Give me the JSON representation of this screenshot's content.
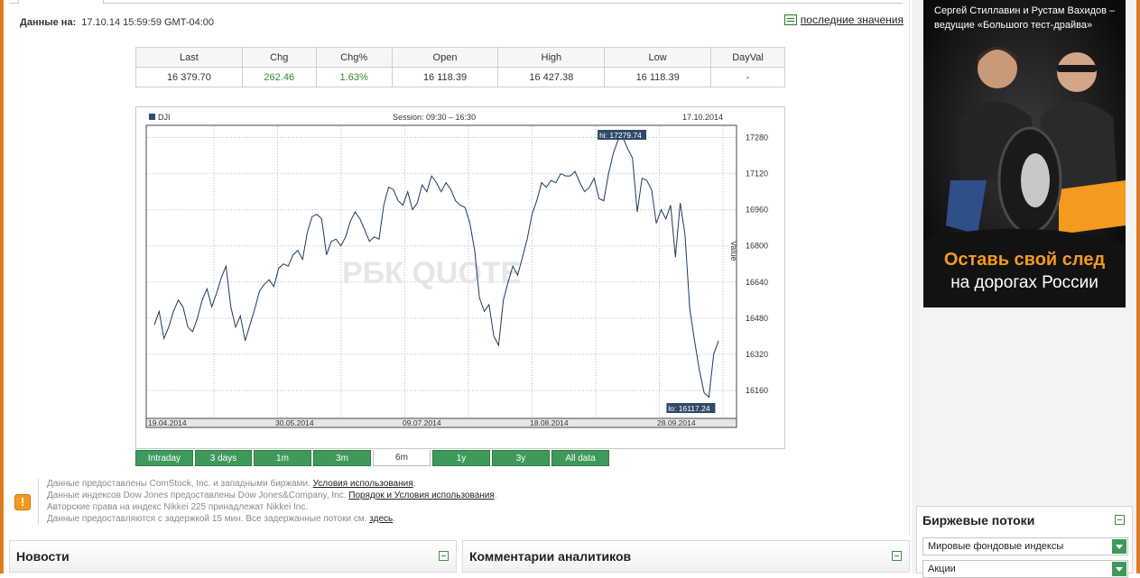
{
  "header": {
    "date_label": "Данные на:",
    "date_value": "17.10.14 15:59:59 GMT-04:00",
    "last_values_link": "последние значения"
  },
  "quote_table": {
    "columns": [
      "Last",
      "Chg",
      "Chg%",
      "Open",
      "High",
      "Low",
      "DayVal"
    ],
    "values": [
      "16 379.70",
      "262.46",
      "1.63%",
      "16 118.39",
      "16 427.38",
      "16 118.39",
      "-"
    ]
  },
  "chart_data": {
    "type": "line",
    "legend": "DJI",
    "session": "Session: 09:30 – 16:30",
    "date": "17.10.2014",
    "watermark": "РБК QUOTE",
    "ylabel": "Value",
    "yticks": [
      16160,
      16320,
      16480,
      16640,
      16800,
      16960,
      17120,
      17280
    ],
    "ylim": [
      16040,
      17330
    ],
    "xticks": [
      "19.04.2014",
      "30.05.2014",
      "09.07.2014",
      "18.08.2014",
      "28.09.2014"
    ],
    "hi_label": "hi: 17279.74",
    "lo_label": "lo: 16117.24",
    "series": [
      {
        "values": [
          16450,
          16510,
          16390,
          16440,
          16510,
          16560,
          16530,
          16440,
          16420,
          16480,
          16560,
          16610,
          16530,
          16590,
          16660,
          16710,
          16530,
          16440,
          16490,
          16380,
          16450,
          16520,
          16600,
          16630,
          16650,
          16620,
          16700,
          16720,
          16710,
          16760,
          16780,
          16740,
          16860,
          16930,
          16940,
          16920,
          16760,
          16820,
          16830,
          16800,
          16840,
          16910,
          16950,
          16920,
          16870,
          16820,
          16840,
          16830,
          16980,
          17060,
          17050,
          17000,
          16980,
          17040,
          16960,
          16990,
          17070,
          17040,
          17110,
          17080,
          17040,
          17080,
          17050,
          17000,
          16980,
          16970,
          16900,
          16780,
          16570,
          16510,
          16540,
          16400,
          16360,
          16560,
          16640,
          16710,
          16670,
          16750,
          16830,
          16940,
          17000,
          17080,
          17060,
          17090,
          17080,
          17120,
          17110,
          17110,
          17130,
          17080,
          17040,
          17060,
          17100,
          17010,
          17000,
          17120,
          17210,
          17270,
          17280,
          17230,
          17190,
          16950,
          17100,
          17090,
          17050,
          16900,
          16960,
          16920,
          16980,
          16750,
          16990,
          16850,
          16520,
          16380,
          16250,
          16150,
          16130,
          16320,
          16380
        ]
      }
    ],
    "x_range": [
      "16.04.2014",
      "17.10.2014"
    ]
  },
  "timeframes": [
    {
      "label": "Intraday",
      "active": false
    },
    {
      "label": "3 days",
      "active": false
    },
    {
      "label": "1m",
      "active": false
    },
    {
      "label": "3m",
      "active": false
    },
    {
      "label": "6m",
      "active": true
    },
    {
      "label": "1y",
      "active": false
    },
    {
      "label": "3y",
      "active": false
    },
    {
      "label": "All data",
      "active": false
    }
  ],
  "notes": {
    "line1": "Данные предоставлены ComStock, Inc. и западными биржами.",
    "line1_link": "Условия использования",
    "line2": "Данные индексов Dow Jones предоставлены Dow Jones&Company, Inc.",
    "line2_link": "Порядок и Условия использования",
    "line3": "Авторские права на индекс Nikkei 225 принадлежат Nikkei Inc.",
    "line4": "Данные предоставляются с задержкой 15 мин. Все задержанные потоки см.",
    "line4_link": "здесь",
    "warn_icon": "!"
  },
  "panels": {
    "news_title": "Новости",
    "analysts_title": "Комментарии аналитиков"
  },
  "ad": {
    "top_text_1": "Сергей Стиллавин и Рустам Вахидов –",
    "top_text_2": "ведущие «Большого тест-драйва»",
    "slogan_1": "Оставь свой след",
    "slogan_2": "на дорогах России"
  },
  "sidebar": {
    "title": "Биржевые потоки",
    "select_1": "Мировые фондовые индексы",
    "select_2": "Акции"
  },
  "colors": {
    "accent_green": "#3e9a5a",
    "frame_orange": "#e07a20",
    "positive": "#2f8a2f",
    "line": "#1c3a5e"
  }
}
